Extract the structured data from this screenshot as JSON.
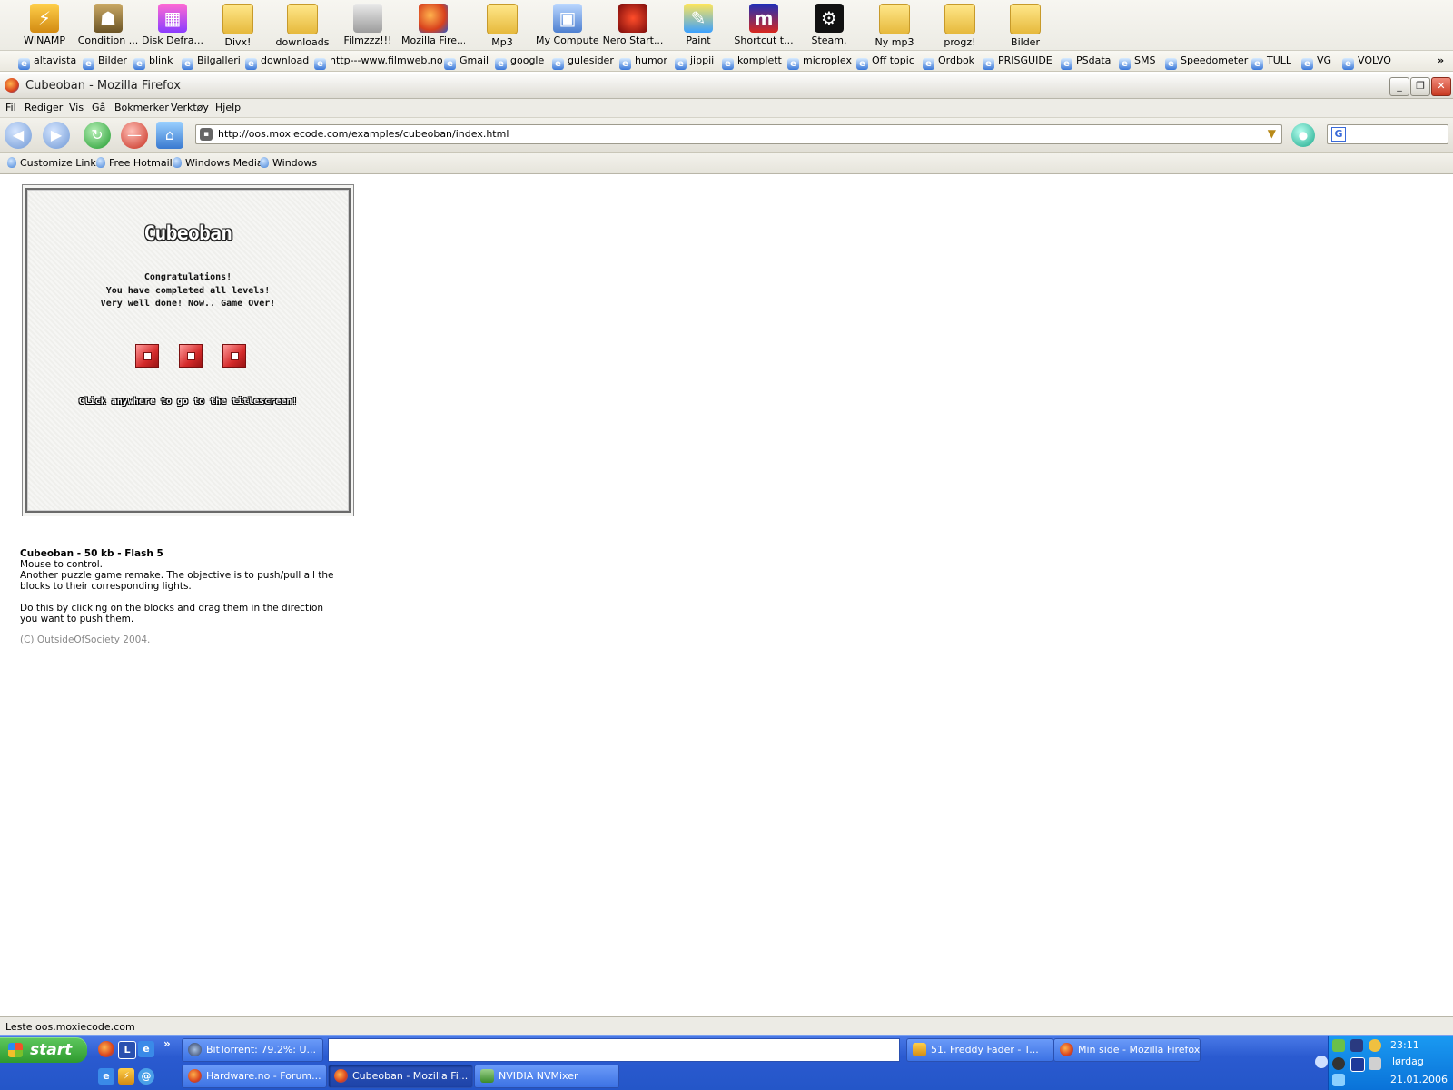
{
  "desktop": {
    "icons": [
      {
        "label": "WINAMP",
        "icon": "winamp-icon"
      },
      {
        "label": "Condition ...",
        "icon": "counter-strike-icon"
      },
      {
        "label": "Disk Defra...",
        "icon": "disk-defrag-icon"
      },
      {
        "label": "Divx!",
        "icon": "folder-icon"
      },
      {
        "label": "downloads",
        "icon": "folder-icon"
      },
      {
        "label": "Filmzzz!!!",
        "icon": "drive-icon"
      },
      {
        "label": "Mozilla Fire...",
        "icon": "firefox-icon"
      },
      {
        "label": "Mp3",
        "icon": "folder-icon"
      },
      {
        "label": "My Computer",
        "icon": "computer-icon"
      },
      {
        "label": "Nero Start...",
        "icon": "nero-icon"
      },
      {
        "label": "Paint",
        "icon": "paint-icon"
      },
      {
        "label": "Shortcut t...",
        "icon": "shortcut-m-icon"
      },
      {
        "label": "Steam.",
        "icon": "steam-icon"
      },
      {
        "label": "Ny mp3",
        "icon": "folder-icon"
      },
      {
        "label": "progz!",
        "icon": "folder-icon"
      },
      {
        "label": "Bilder",
        "icon": "folder-icon"
      }
    ]
  },
  "links": [
    "altavista",
    "Bilder",
    "blink",
    "Bilgalleri",
    "download",
    "http---www.filmweb.no",
    "Gmail",
    "google",
    "gulesider",
    "humor",
    "jippii",
    "komplett",
    "microplex",
    "Off topic",
    "Ordbok",
    "PRISGUIDE",
    "PSdata",
    "SMS",
    "Speedometer",
    "TULL",
    "VG",
    "VOLVO"
  ],
  "links_overflow": "»",
  "window": {
    "title": "Cubeoban - Mozilla Firefox",
    "minimize": "_",
    "maximize": "❐",
    "close": "✕"
  },
  "menu": [
    "Fil",
    "Rediger",
    "Vis",
    "Gå",
    "Bokmerker",
    "Verktøy",
    "Hjelp"
  ],
  "nav": {
    "url": "http://oos.moxiecode.com/examples/cubeoban/index.html",
    "search_value": "",
    "search_engine_letter": "G"
  },
  "personal_toolbar": [
    "Customize Links",
    "Free Hotmail",
    "Windows Media",
    "Windows"
  ],
  "game": {
    "title": "Cubeoban",
    "line1": "Congratulations!",
    "line2": "You have completed all levels!",
    "line3": "Very well done! Now.. Game Over!",
    "hint": "Click anywhere to go to the titlescreen!"
  },
  "info": {
    "heading": "Cubeoban - 50 kb - Flash 5",
    "line1": "Mouse to control.",
    "line2": "Another puzzle game remake. The objective is to push/pull all the",
    "line3": "blocks to their corresponding lights.",
    "line4": "Do this by clicking on the blocks and drag them in the direction",
    "line5": "you want to push them.",
    "copyright": "(C) OutsideOfSociety 2004."
  },
  "status": "Leste oos.moxiecode.com",
  "taskbar": {
    "start_label": "start",
    "tasks_row1": [
      {
        "label": "BitTorrent: 79.2%: U...",
        "icon": "bittorrent-icon"
      },
      {
        "label": "51. Freddy Fader - T...",
        "icon": "winamp-icon"
      },
      {
        "label": "Min side - Mozilla Firefox",
        "icon": "firefox-icon"
      }
    ],
    "tasks_row2": [
      {
        "label": "Hardware.no - Forum...",
        "icon": "firefox-icon"
      },
      {
        "label": "Cubeoban - Mozilla Fi...",
        "icon": "firefox-icon",
        "active": true
      },
      {
        "label": "NVIDIA NVMixer",
        "icon": "nvidia-icon"
      }
    ],
    "quick_launch_overflow": "»",
    "tray": {
      "time": "23:11",
      "day": "lørdag",
      "date": "21.01.2006"
    }
  }
}
